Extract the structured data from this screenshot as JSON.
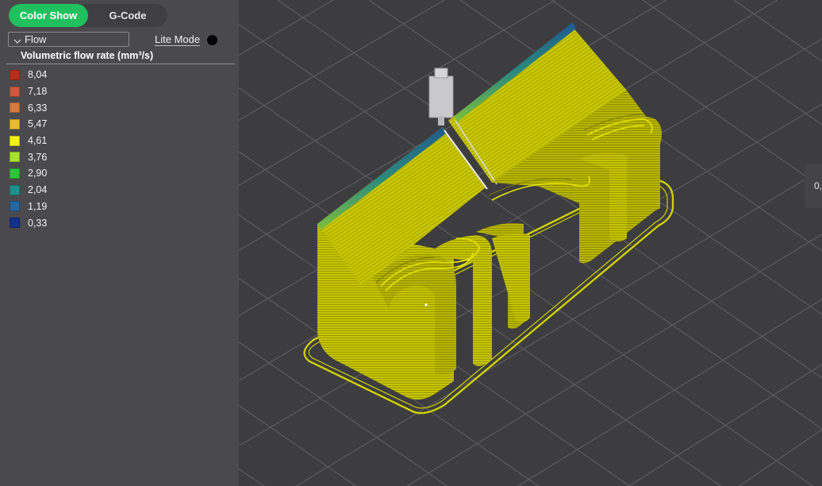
{
  "tabs": [
    {
      "label": "Color Show",
      "active": true
    },
    {
      "label": "G-Code",
      "active": false
    }
  ],
  "view_type": {
    "selected": "Flow"
  },
  "lite_mode": {
    "label": "Lite Mode",
    "enabled": false
  },
  "legend": {
    "title": "Volumetric flow rate (mm³/s)",
    "items": [
      {
        "value": "8,04",
        "color": "#b52f1b"
      },
      {
        "value": "7,18",
        "color": "#c75a3c"
      },
      {
        "value": "6,33",
        "color": "#d37a3e"
      },
      {
        "value": "5,47",
        "color": "#e8bc2a"
      },
      {
        "value": "4,61",
        "color": "#f2f21b"
      },
      {
        "value": "3,76",
        "color": "#a8e326"
      },
      {
        "value": "2,90",
        "color": "#2ec53a"
      },
      {
        "value": "2,04",
        "color": "#21908c"
      },
      {
        "value": "1,19",
        "color": "#2466a0"
      },
      {
        "value": "0,33",
        "color": "#14308a"
      }
    ]
  },
  "right_readout": {
    "text": "0,"
  },
  "colors": {
    "accent": "#1fc15f",
    "panel_bg": "#4a4a4d",
    "viewport_bg": "#3d3d40",
    "print_yellow": "#c4c800",
    "grid_line": "#5f5f62"
  }
}
